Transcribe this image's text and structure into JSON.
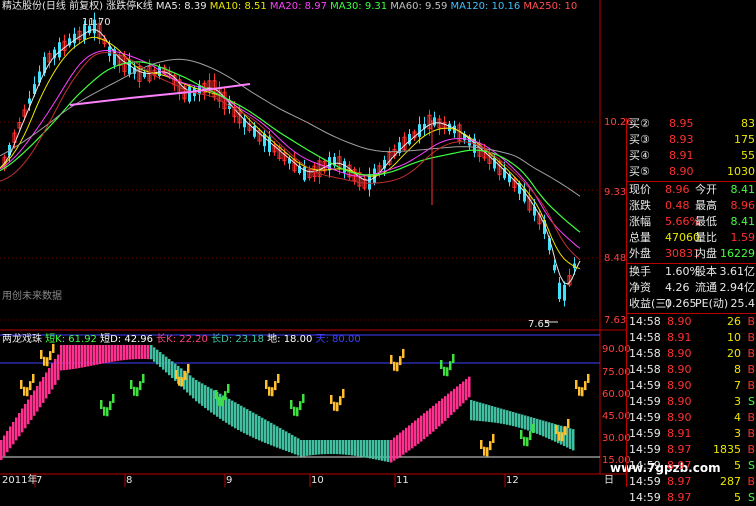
{
  "header": {
    "title": "精达股份(日线 前复权) 涨跌停K线",
    "ma": [
      {
        "text": "MA5: 8.39",
        "color": "#e8e8e8"
      },
      {
        "text": "MA10: 8.51",
        "color": "#e8e800"
      },
      {
        "text": "MA20: 8.97",
        "color": "#ff40ff"
      },
      {
        "text": "MA30: 9.31",
        "color": "#40ff40"
      },
      {
        "text": "MA60: 9.59",
        "color": "#c0c0c0"
      },
      {
        "text": "MA120: 10.16",
        "color": "#40c0ff"
      },
      {
        "text": "MA250: 10",
        "color": "#ff5050"
      }
    ]
  },
  "main_chart": {
    "price_ticks": [
      "10.26",
      "9.33",
      "8.48",
      "7.63"
    ],
    "high_label": "11.70",
    "low_label": "7.65",
    "note": "用创未来数据"
  },
  "indicator": {
    "title": "两龙戏珠",
    "items": [
      {
        "text": "短K: 61.92",
        "color": "#40ff40"
      },
      {
        "text": "短D: 42.96",
        "color": "#ffffff"
      },
      {
        "text": "长K: 22.20",
        "color": "#ff4080"
      },
      {
        "text": "长D: 23.18",
        "color": "#40c0a0"
      },
      {
        "text": "地: 18.00",
        "color": "#ffffff"
      },
      {
        "text": "天: 80.00",
        "color": "#4040ff"
      }
    ],
    "ticks": [
      "90.00",
      "75.00",
      "60.00",
      "45.00",
      "30.00",
      "15.00"
    ]
  },
  "date_axis": [
    "2011年",
    "7",
    "8",
    "9",
    "10",
    "11",
    "12",
    "日"
  ],
  "quotes": {
    "bids": [
      {
        "label": "买②",
        "price": "8.95",
        "vol": "83"
      },
      {
        "label": "买③",
        "price": "8.93",
        "vol": "175"
      },
      {
        "label": "买④",
        "price": "8.91",
        "vol": "55"
      },
      {
        "label": "买⑤",
        "price": "8.90",
        "vol": "1030"
      }
    ],
    "stats": [
      {
        "l1": "现价",
        "v1": "8.96",
        "c1": "#ff3030",
        "l2": "今开",
        "v2": "8.41",
        "c2": "#40ff40"
      },
      {
        "l1": "涨跌",
        "v1": "0.48",
        "c1": "#ff3030",
        "l2": "最高",
        "v2": "8.96",
        "c2": "#ff3030"
      },
      {
        "l1": "涨幅",
        "v1": "5.66%",
        "c1": "#ff3030",
        "l2": "最低",
        "v2": "8.41",
        "c2": "#40ff40"
      },
      {
        "l1": "总量",
        "v1": "47060",
        "c1": "#e8e800",
        "l2": "量比",
        "v2": "1.59",
        "c2": "#ff3030"
      },
      {
        "l1": "外盘",
        "v1": "30831",
        "c1": "#ff3030",
        "l2": "内盘",
        "v2": "16229",
        "c2": "#40ff40"
      },
      {
        "l1": "换手",
        "v1": "1.60%",
        "c1": "#e8e8e8",
        "l2": "股本",
        "v2": "3.61亿",
        "c2": "#e8e8e8"
      },
      {
        "l1": "净资",
        "v1": "4.26",
        "c1": "#e8e8e8",
        "l2": "流通",
        "v2": "2.94亿",
        "c2": "#e8e8e8"
      },
      {
        "l1": "收益(三)",
        "v1": "0.265",
        "c1": "#e8e8e8",
        "l2": "PE(动)",
        "v2": "25.4",
        "c2": "#e8e8e8"
      }
    ],
    "trades": [
      {
        "time": "14:58",
        "price": "8.90",
        "vol": "26",
        "bs": "B",
        "bc": "#ff3030"
      },
      {
        "time": "14:58",
        "price": "8.91",
        "vol": "10",
        "bs": "B",
        "bc": "#ff3030"
      },
      {
        "time": "14:58",
        "price": "8.90",
        "vol": "20",
        "bs": "B",
        "bc": "#ff3030"
      },
      {
        "time": "14:58",
        "price": "8.90",
        "vol": "8",
        "bs": "B",
        "bc": "#ff3030"
      },
      {
        "time": "14:59",
        "price": "8.90",
        "vol": "7",
        "bs": "B",
        "bc": "#ff3030"
      },
      {
        "time": "14:59",
        "price": "8.90",
        "vol": "3",
        "bs": "S",
        "bc": "#40ff40"
      },
      {
        "time": "14:59",
        "price": "8.90",
        "vol": "4",
        "bs": "B",
        "bc": "#ff3030"
      },
      {
        "time": "14:59",
        "price": "8.91",
        "vol": "3",
        "bs": "B",
        "bc": "#ff3030"
      },
      {
        "time": "14:59",
        "price": "8.97",
        "vol": "1835",
        "bs": "B",
        "bc": "#ff3030"
      },
      {
        "time": "14:59",
        "price": "8.97",
        "vol": "5",
        "bs": "S",
        "bc": "#40ff40"
      },
      {
        "time": "14:59",
        "price": "8.97",
        "vol": "287",
        "bs": "B",
        "bc": "#ff3030"
      },
      {
        "time": "14:59",
        "price": "8.97",
        "vol": "5",
        "bs": "S",
        "bc": "#40ff40"
      }
    ]
  },
  "watermark": "www.7gpzb.com"
}
